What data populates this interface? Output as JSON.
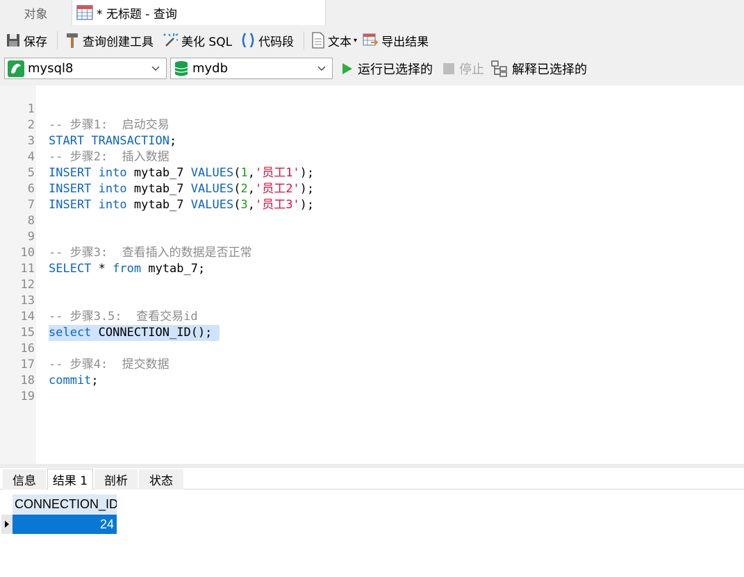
{
  "tabs": {
    "objects": "对象",
    "query": "* 无标题 - 查询"
  },
  "toolbar": {
    "save": "保存",
    "query_builder": "查询创建工具",
    "beautify": "美化 SQL",
    "snippet": "代码段",
    "text": "文本",
    "export": "导出结果"
  },
  "toolbar2": {
    "connection": "mysql8",
    "database": "mydb",
    "run_selected": "运行已选择的",
    "stop": "停止",
    "explain_selected": "解释已选择的"
  },
  "editor": {
    "line_numbers": [
      "1",
      "2",
      "3",
      "4",
      "5",
      "6",
      "7",
      "8",
      "9",
      "10",
      "11",
      "12",
      "13",
      "14",
      "15",
      "16",
      "17",
      "18",
      "19"
    ],
    "l1": "-- 步骤1:  启动交易",
    "l2_kw": "START TRANSACTION",
    "l2_end": ";",
    "l3": "-- 步骤2:  插入数据",
    "ins_kw": "INSERT",
    "into_kw": "into",
    "table": "mytab_7",
    "values_kw": "VALUES",
    "open": "(",
    "comma": ",",
    "close": ");",
    "r1_num": "1",
    "r1_str": "'员工1'",
    "r2_num": "2",
    "r2_str": "'员工2'",
    "r3_num": "3",
    "r3_str": "'员工3'",
    "l9": "-- 步骤3:  查看插入的数据是否正常",
    "select_kw": "SELECT",
    "star": " * ",
    "from_kw": "from",
    "l10_table": " mytab_7;",
    "l13": "-- 步骤3.5:  查看交易id",
    "l14_kw": "select",
    "l14_rest": " CONNECTION_ID();",
    "l16": "-- 步骤4:  提交数据",
    "l17_kw": "commit",
    "l17_end": ";"
  },
  "result_tabs": {
    "info": "信息",
    "result1": "结果 1",
    "profile": "剖析",
    "status": "状态"
  },
  "grid": {
    "column": "CONNECTION_ID()",
    "value": "24"
  },
  "colors": {
    "keyword": "#0b64c8",
    "comment": "#8c8c8c",
    "number": "#10a010",
    "string": "#d8103a",
    "selection": "#0878d4"
  }
}
